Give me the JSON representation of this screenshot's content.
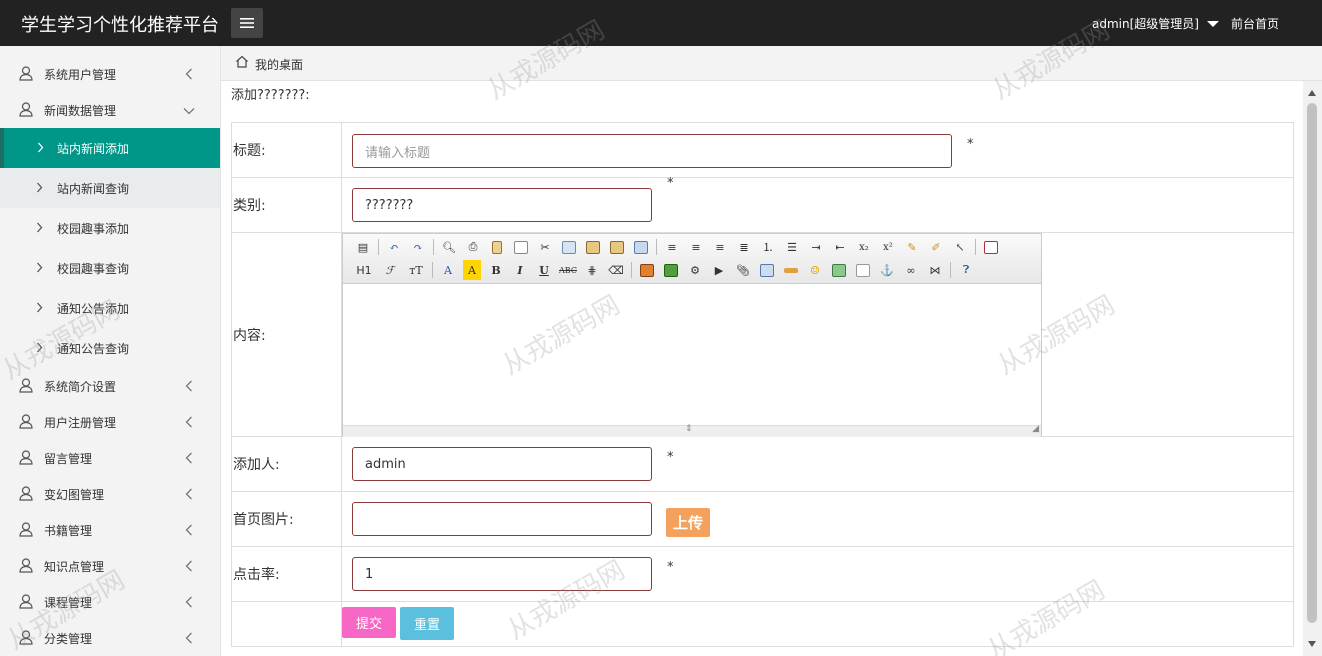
{
  "app": {
    "title": "学生学习个性化推荐平台",
    "user": "admin[超级管理员]",
    "home_link": "前台首页"
  },
  "sidebar": {
    "groups": [
      {
        "label": "系统用户管理"
      },
      {
        "label": "新闻数据管理"
      },
      {
        "label": "系统简介设置"
      },
      {
        "label": "用户注册管理"
      },
      {
        "label": "留言管理"
      },
      {
        "label": "变幻图管理"
      },
      {
        "label": "书籍管理"
      },
      {
        "label": "知识点管理"
      },
      {
        "label": "课程管理"
      },
      {
        "label": "分类管理"
      }
    ],
    "subitems": [
      {
        "label": "站内新闻添加"
      },
      {
        "label": "站内新闻查询"
      },
      {
        "label": "校园趣事添加"
      },
      {
        "label": "校园趣事查询"
      },
      {
        "label": "通知公告添加"
      },
      {
        "label": "通知公告查询"
      }
    ],
    "active_color": "#009688"
  },
  "breadcrumb": {
    "label": "我的桌面"
  },
  "page": {
    "heading": "添加???????:"
  },
  "form": {
    "title_label": "标题:",
    "title_placeholder": "请输入标题",
    "category_label": "类别:",
    "category_value": "???????",
    "content_label": "内容:",
    "author_label": "添加人:",
    "author_value": "admin",
    "image_label": "首页图片:",
    "image_value": "",
    "upload_label": "上传",
    "clicks_label": "点击率:",
    "clicks_value": "1",
    "required_mark": "*",
    "submit_label": "提交",
    "reset_label": "重置"
  },
  "editor": {
    "toolbar_text": {
      "heading": "H1",
      "font": "ℱ",
      "size": "тT",
      "fontcolor": "A",
      "bgcolor": "A",
      "bold": "B",
      "italic": "I",
      "underline": "U",
      "strike": "ABC"
    }
  },
  "watermark": "从戎源码网"
}
